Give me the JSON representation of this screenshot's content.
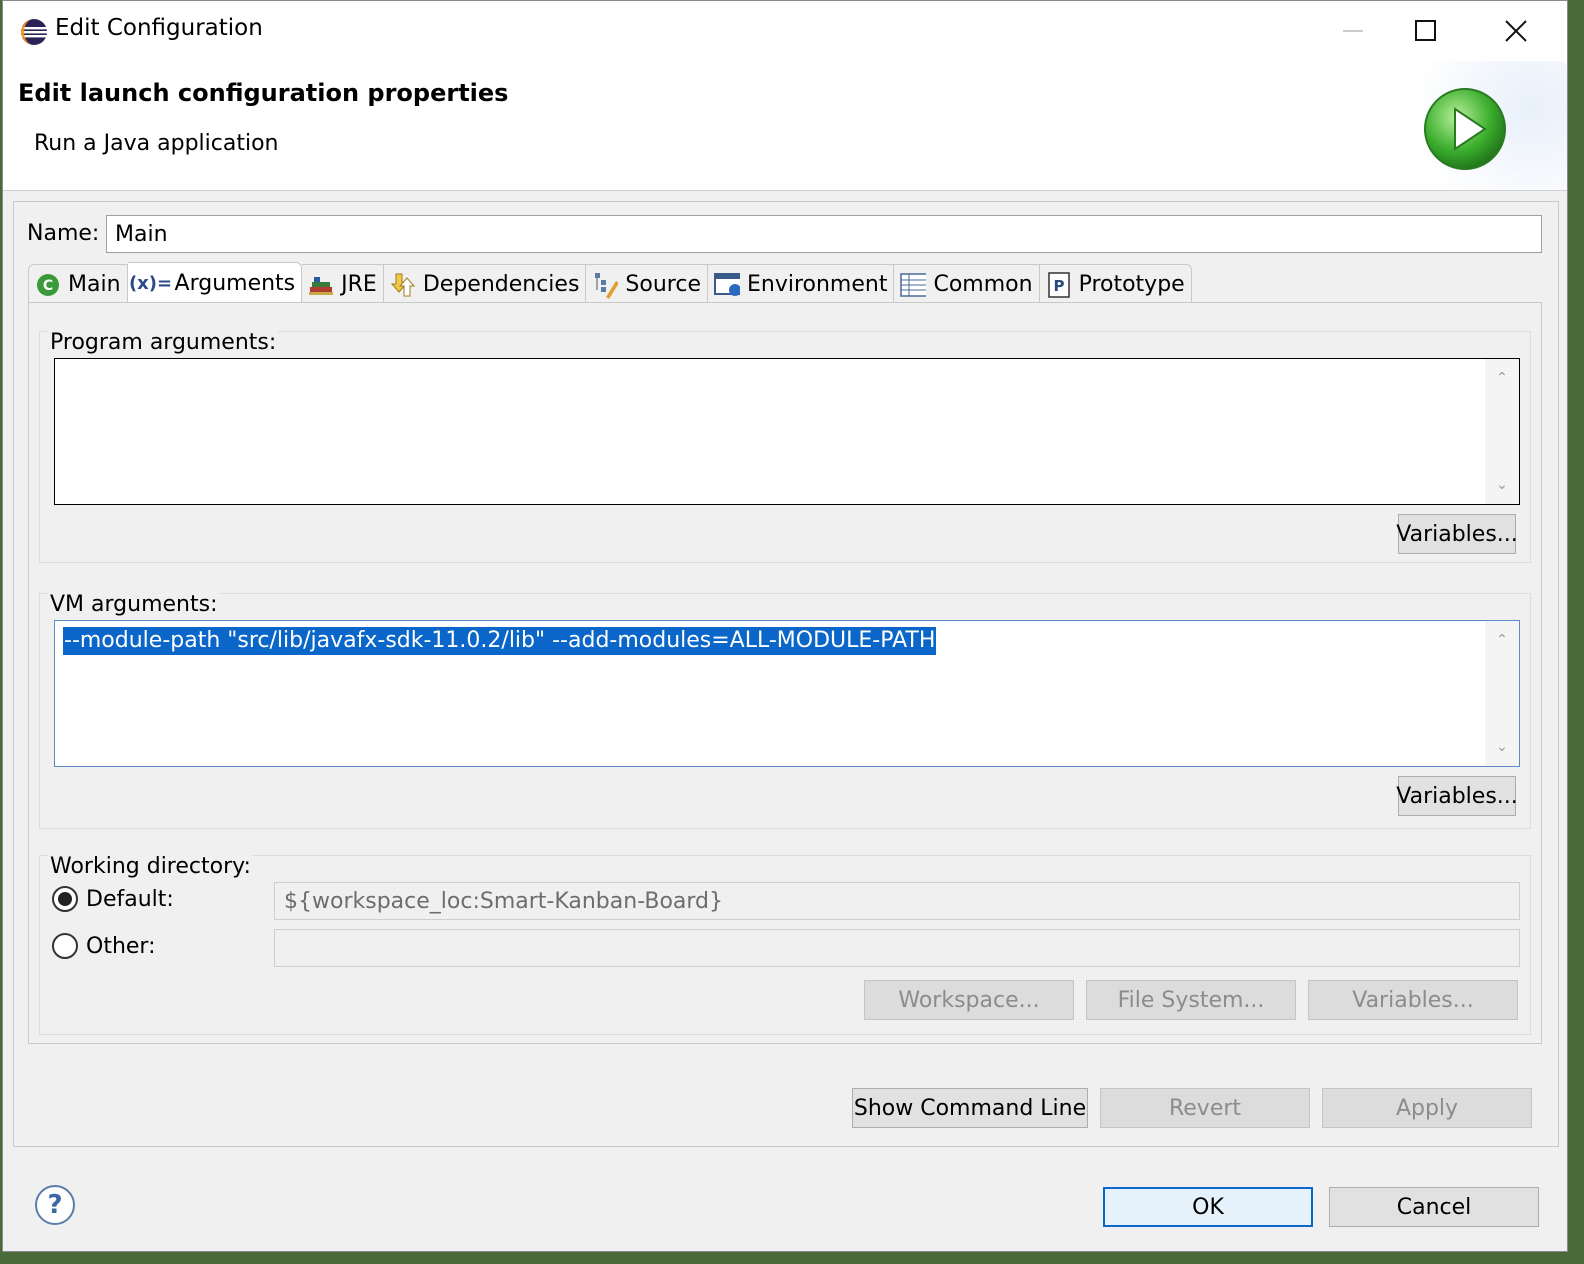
{
  "window": {
    "title": "Edit Configuration"
  },
  "banner": {
    "title": "Edit launch configuration properties",
    "subtitle": "Run a Java application"
  },
  "name": {
    "label": "Name:",
    "value": "Main"
  },
  "tabs": [
    {
      "label": "Main",
      "icon": "class-c-icon"
    },
    {
      "label": "Arguments",
      "icon": "arguments-x-icon"
    },
    {
      "label": "JRE",
      "icon": "library-books-icon"
    },
    {
      "label": "Dependencies",
      "icon": "dependencies-icon"
    },
    {
      "label": "Source",
      "icon": "source-tree-icon"
    },
    {
      "label": "Environment",
      "icon": "environment-icon"
    },
    {
      "label": "Common",
      "icon": "table-icon"
    },
    {
      "label": "Prototype",
      "icon": "prototype-p-icon"
    }
  ],
  "active_tab": "Arguments",
  "program_args": {
    "label": "Program arguments:",
    "value": "",
    "variables_label": "Variables..."
  },
  "vm_args": {
    "label": "VM arguments:",
    "value": "--module-path \"src/lib/javafx-sdk-11.0.2/lib\" --add-modules=ALL-MODULE-PATH",
    "variables_label": "Variables..."
  },
  "working_dir": {
    "label": "Working directory:",
    "default_label": "Default:",
    "default_value": "${workspace_loc:Smart-Kanban-Board}",
    "other_label": "Other:",
    "other_value": "",
    "selected": "Default",
    "workspace_label": "Workspace...",
    "filesystem_label": "File System...",
    "variables_label": "Variables..."
  },
  "actions": {
    "show_cmd": "Show Command Line",
    "revert": "Revert",
    "apply": "Apply"
  },
  "footer": {
    "help": "?",
    "ok": "OK",
    "cancel": "Cancel"
  },
  "colors": {
    "selection": "#0a66c8",
    "accent": "#0a66c8",
    "run_icon": "#3cae2e"
  }
}
